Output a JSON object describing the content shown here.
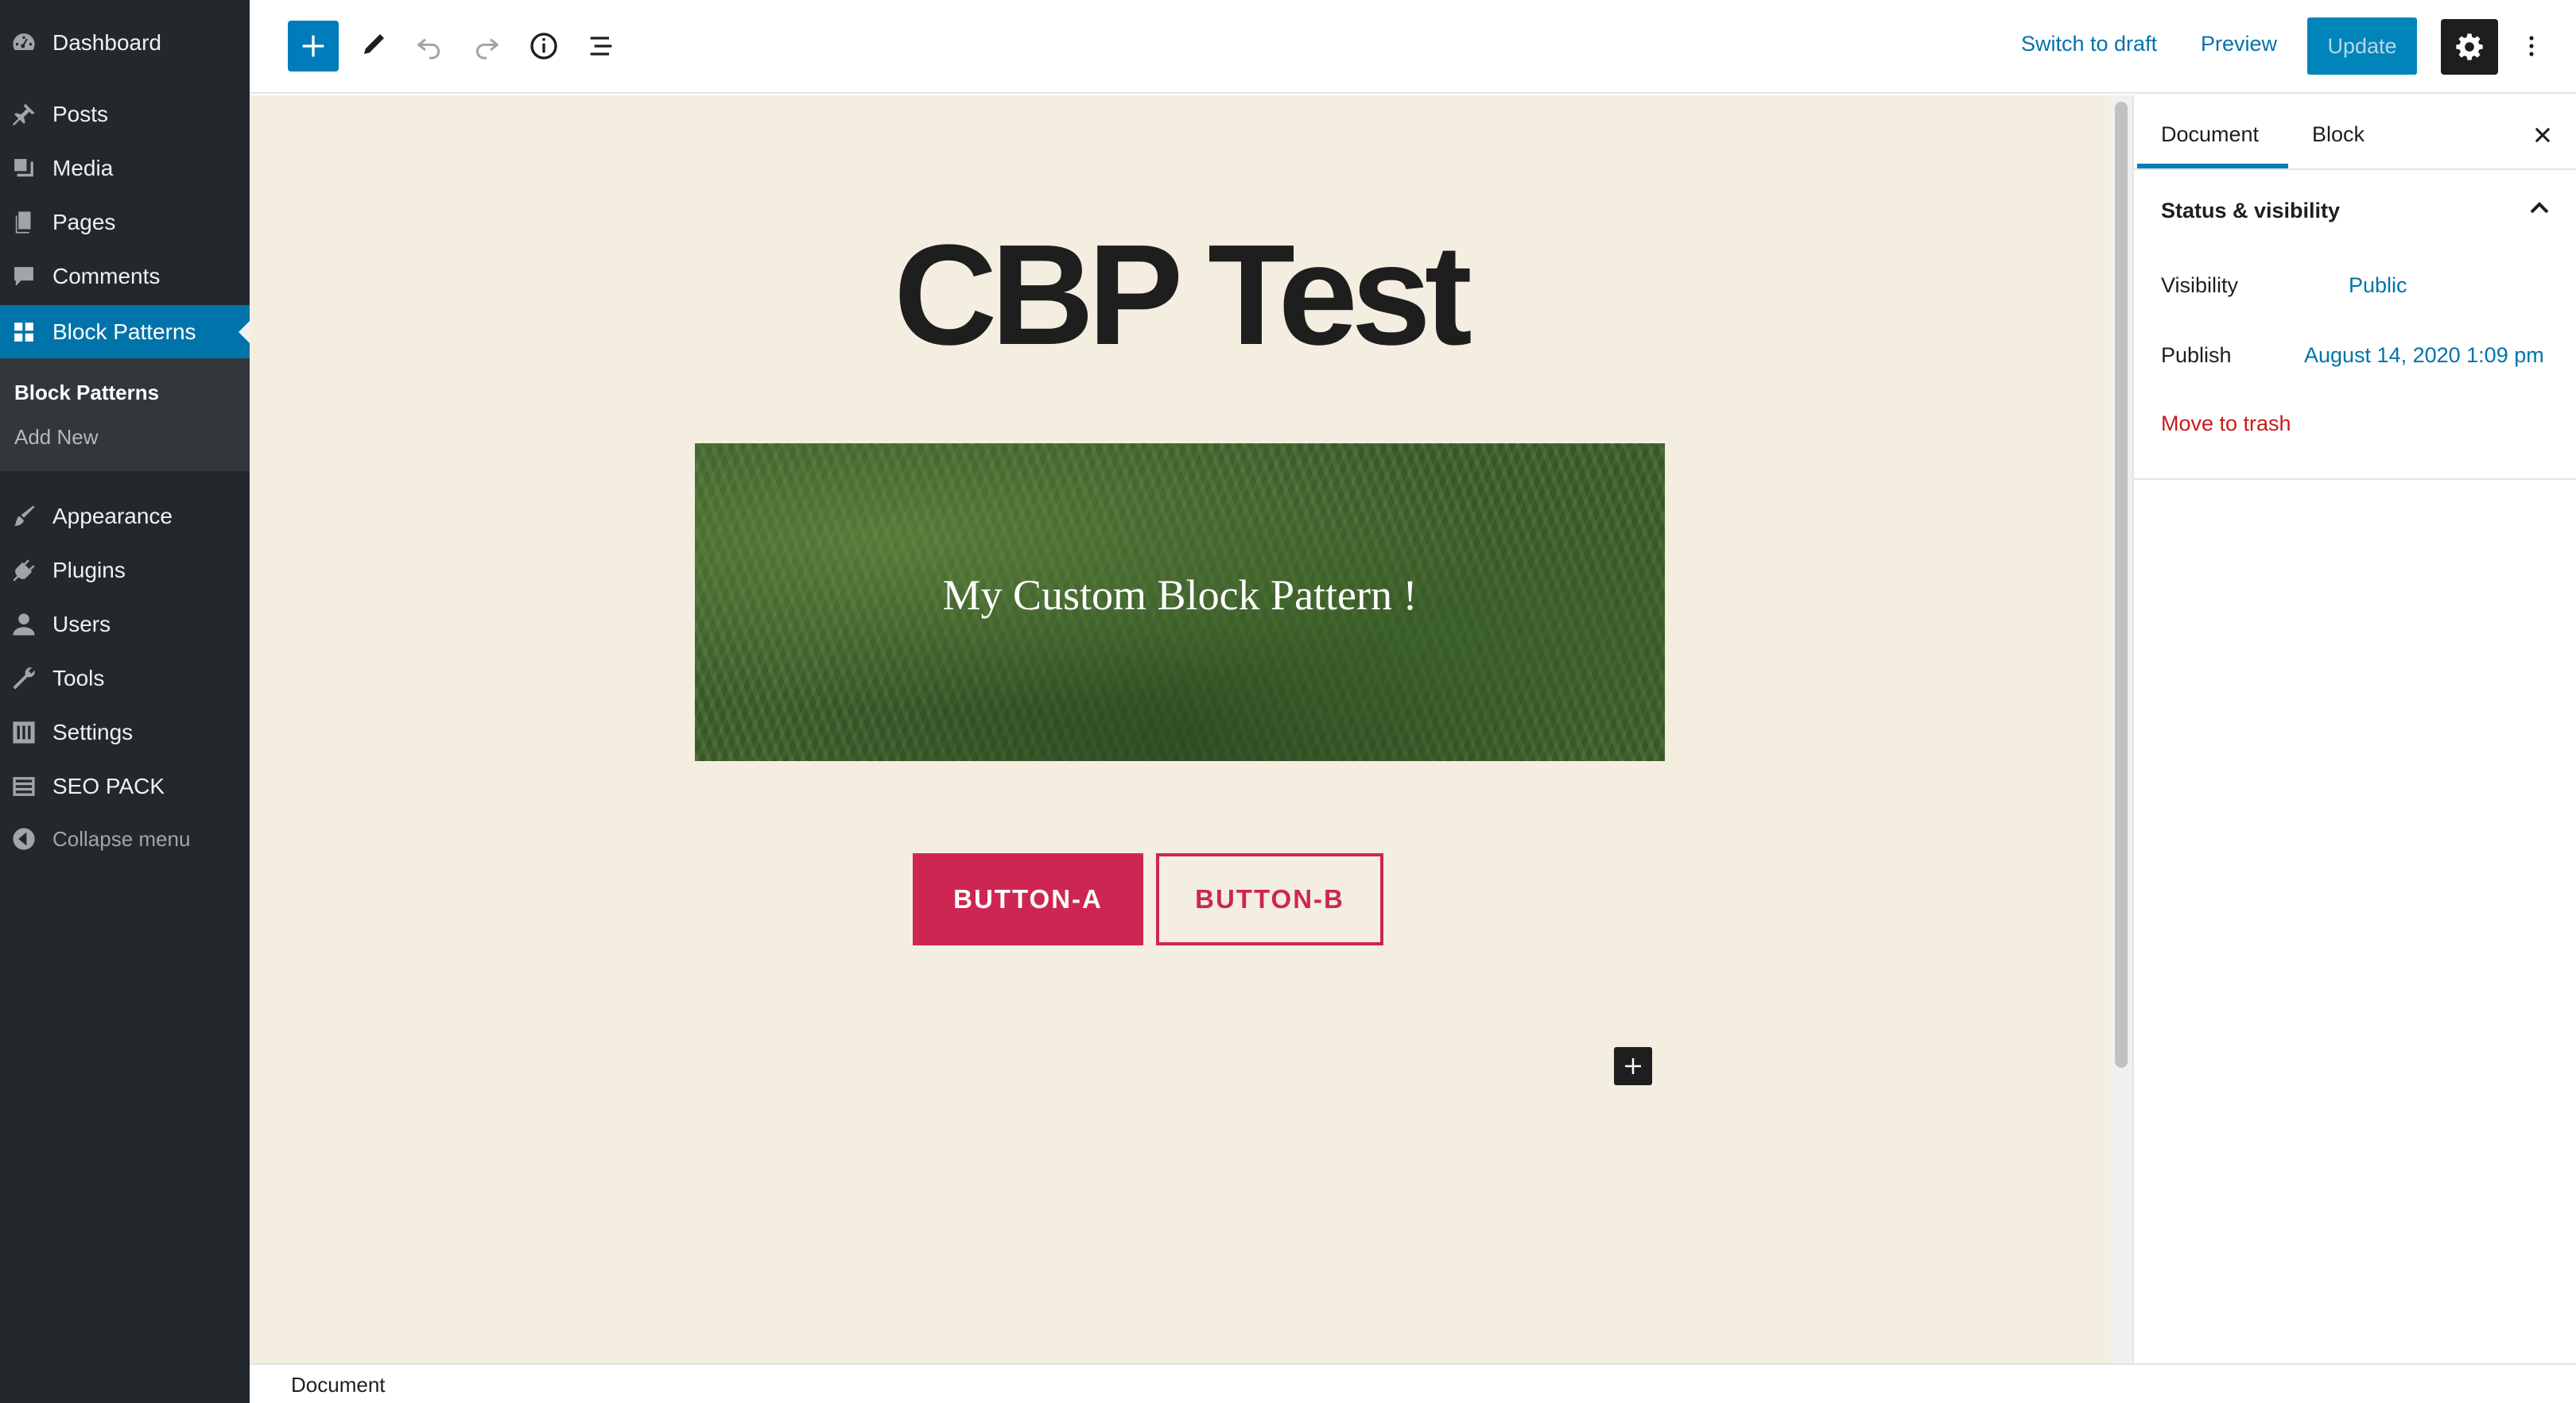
{
  "admin_menu": {
    "items": [
      {
        "label": "Dashboard",
        "icon": "dashboard-icon"
      },
      {
        "label": "Posts",
        "icon": "pin-icon"
      },
      {
        "label": "Media",
        "icon": "media-icon"
      },
      {
        "label": "Pages",
        "icon": "pages-icon"
      },
      {
        "label": "Comments",
        "icon": "comment-icon"
      },
      {
        "label": "Block Patterns",
        "icon": "grid-icon"
      },
      {
        "label": "Appearance",
        "icon": "brush-icon"
      },
      {
        "label": "Plugins",
        "icon": "plug-icon"
      },
      {
        "label": "Users",
        "icon": "user-icon"
      },
      {
        "label": "Tools",
        "icon": "wrench-icon"
      },
      {
        "label": "Settings",
        "icon": "sliders-icon"
      },
      {
        "label": "SEO PACK",
        "icon": "list-icon"
      },
      {
        "label": "Collapse menu",
        "icon": "collapse-icon"
      }
    ],
    "submenu": [
      {
        "label": "Block Patterns"
      },
      {
        "label": "Add New"
      }
    ],
    "colors": {
      "background": "#23282d",
      "current": "#0073aa",
      "submenu": "#32373c"
    }
  },
  "toolbar": {
    "switch_to_draft": "Switch to draft",
    "preview": "Preview",
    "update": "Update",
    "icons": [
      "add-block-icon",
      "edit-icon",
      "undo-icon",
      "redo-icon",
      "info-icon",
      "list-view-icon",
      "gear-icon",
      "more-vertical-icon"
    ]
  },
  "canvas": {
    "title": "CBP Test",
    "cover_text": "My Custom Block Pattern !",
    "button_a": "BUTTON-A",
    "button_b": "BUTTON-B",
    "background": "#f3eedf",
    "accent": "#cd2653"
  },
  "sidebar": {
    "tabs": [
      "Document",
      "Block"
    ],
    "active_tab": "Document",
    "panel_title": "Status & visibility",
    "visibility_label": "Visibility",
    "visibility_value": "Public",
    "publish_label": "Publish",
    "publish_value": "August 14, 2020 1:09 pm",
    "trash": "Move to trash"
  },
  "footer": {
    "breadcrumb": "Document"
  }
}
